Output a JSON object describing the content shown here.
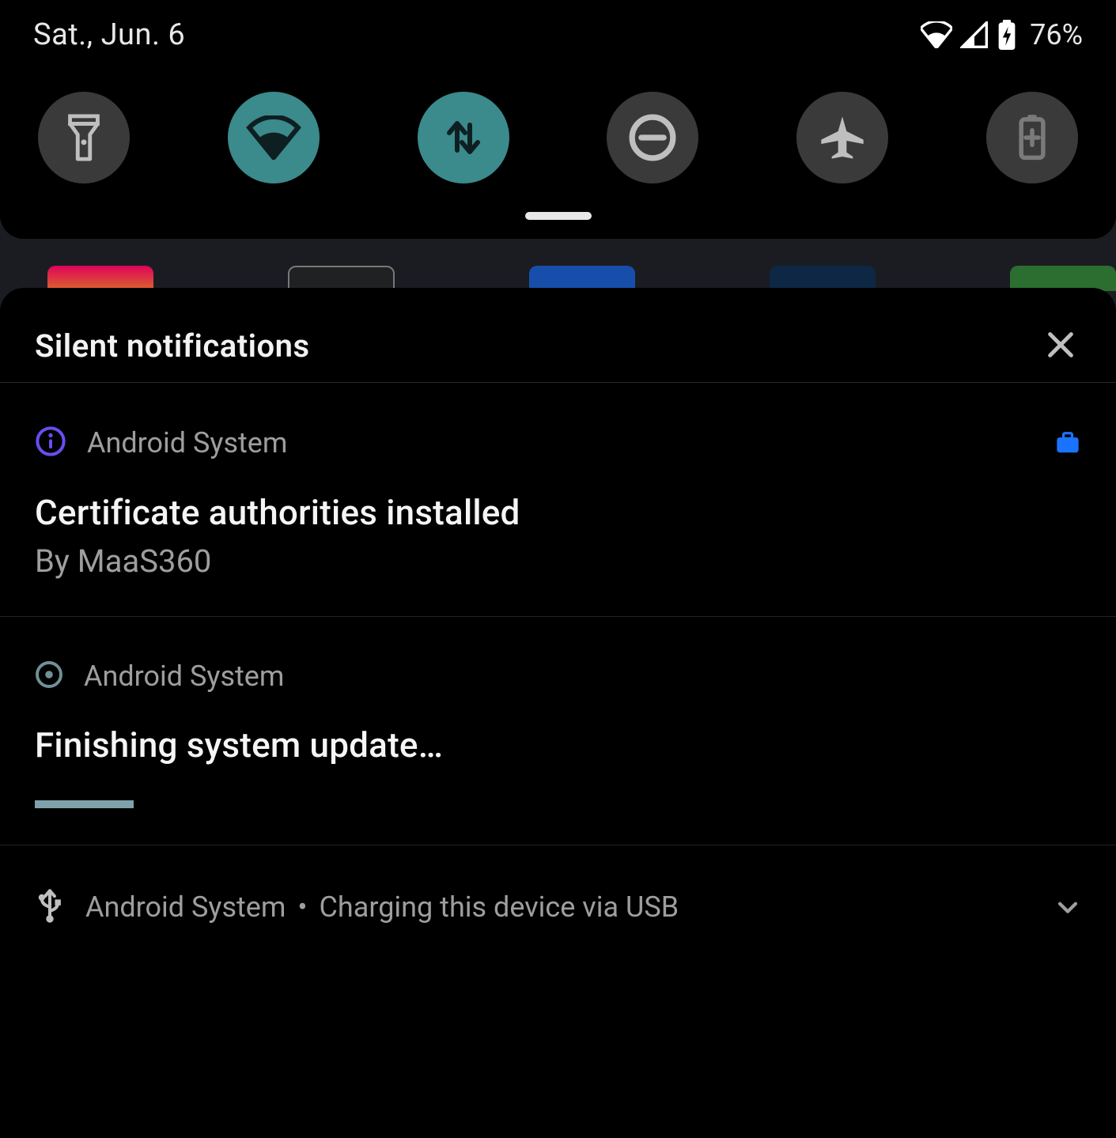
{
  "status": {
    "date": "Sat., Jun. 6",
    "battery_pct": "76%"
  },
  "qs": {
    "tiles": [
      {
        "name": "flashlight",
        "active": false
      },
      {
        "name": "wifi",
        "active": true
      },
      {
        "name": "mobile-data",
        "active": true
      },
      {
        "name": "do-not-disturb",
        "active": false
      },
      {
        "name": "airplane-mode",
        "active": false
      },
      {
        "name": "battery-saver",
        "active": false
      }
    ]
  },
  "section": {
    "title": "Silent notifications"
  },
  "notifications": [
    {
      "app": "Android System",
      "title": "Certificate authorities installed",
      "body": "By MaaS360",
      "icon_color": "#6a4df0",
      "work_profile": true
    },
    {
      "app": "Android System",
      "title": "Finishing system update…",
      "icon_color": "#6f9097",
      "progress_pct": 9
    },
    {
      "app": "Android System",
      "collapsed": true,
      "summary": "Charging this device via USB"
    }
  ]
}
